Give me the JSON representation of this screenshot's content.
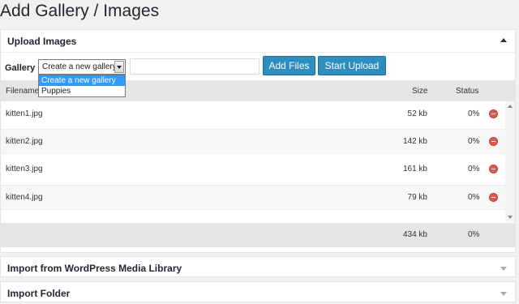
{
  "page": {
    "title": "Add Gallery / Images"
  },
  "upload": {
    "heading": "Upload Images",
    "gallery_label": "Gallery",
    "gallery_selected": "Create a new gallery",
    "gallery_options": [
      "Create a new gallery",
      "Puppies"
    ],
    "add_files": "Add Files",
    "start_upload": "Start Upload"
  },
  "table": {
    "headers": {
      "filename": "Filename",
      "size": "Size",
      "status": "Status"
    },
    "rows": [
      {
        "name": "kitten1.jpg",
        "size": "52 kb",
        "status": "0%"
      },
      {
        "name": "kitten2.jpg",
        "size": "142 kb",
        "status": "0%"
      },
      {
        "name": "kitten3.jpg",
        "size": "161 kb",
        "status": "0%"
      },
      {
        "name": "kitten4.jpg",
        "size": "79 kb",
        "status": "0%"
      }
    ],
    "total": {
      "size": "434 kb",
      "status": "0%"
    }
  },
  "import_media": {
    "heading": "Import from WordPress Media Library"
  },
  "import_folder": {
    "heading": "Import Folder"
  },
  "icons": {
    "remove": "remove-icon",
    "collapse": "arrow-up-icon",
    "expand": "arrow-down-icon"
  },
  "colors": {
    "button": "#2e8ec0",
    "remove": "#e05a4f",
    "dropdown_selected": "#3399ff"
  }
}
